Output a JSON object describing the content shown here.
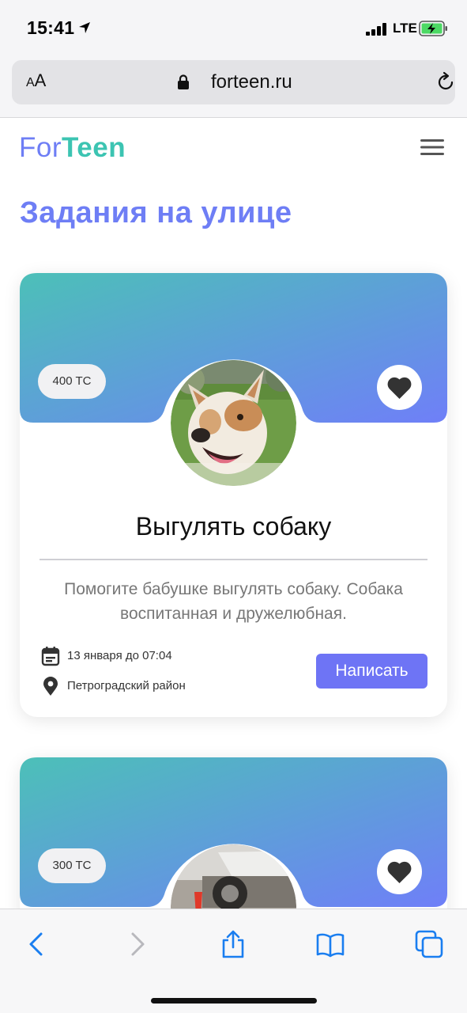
{
  "status_bar": {
    "time": "15:41",
    "network": "LTE"
  },
  "browser": {
    "text_size_label": "AA",
    "url": "forteen.ru"
  },
  "site": {
    "logo_part1": "For",
    "logo_part2": "Teen"
  },
  "page": {
    "title": "Задания на улице"
  },
  "tasks": [
    {
      "reward": "400 TC",
      "title": "Выгулять собаку",
      "description": "Помогите бабушке выгулять собаку. Собака воспитанная и дружелюбная.",
      "date": "13 января до 07:04",
      "location": "Петроградский район",
      "action_label": "Написать"
    },
    {
      "reward": "300 TC"
    }
  ],
  "colors": {
    "brand_purple": "#6e7ef5",
    "brand_teal": "#3cc4b2",
    "gradient_start": "#4cc0b8",
    "gradient_end": "#6f7ff8",
    "button": "#6e74f5",
    "ios_blue": "#1a7ef0"
  },
  "icons": {
    "status": [
      "location-arrow-icon",
      "signal-icon",
      "battery-charging-icon"
    ],
    "browser": [
      "lock-icon",
      "reload-icon"
    ],
    "card": [
      "heart-icon",
      "calendar-icon",
      "map-pin-icon"
    ],
    "toolbar": [
      "back-icon",
      "forward-icon",
      "share-icon",
      "bookmarks-icon",
      "tabs-icon"
    ]
  }
}
